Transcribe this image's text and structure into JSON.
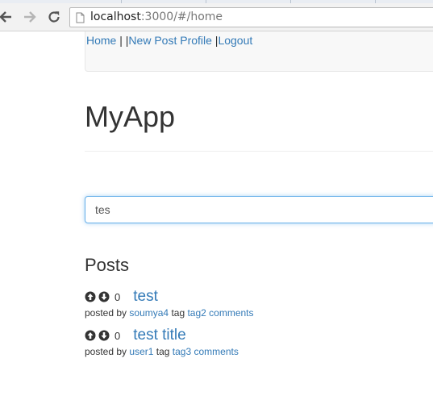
{
  "browser": {
    "url_host": "localhost",
    "url_path": ":3000/#/home"
  },
  "navbar": {
    "home": "Home",
    "sep1": " | |",
    "new_post": "New Post",
    "space": " ",
    "profile": "Profile",
    "sep2": " |",
    "logout": "Logout"
  },
  "header": {
    "title": "MyApp"
  },
  "search": {
    "value": "tes"
  },
  "posts": {
    "heading": "Posts",
    "posted_by_label": "posted by",
    "tag_label": "tag",
    "items": [
      {
        "votes": "0",
        "title": "test",
        "author": "soumya4",
        "tag": "tag2",
        "comments": "comments"
      },
      {
        "votes": "0",
        "title": "test title",
        "author": "user1",
        "tag": "tag3",
        "comments": "comments"
      }
    ]
  },
  "colors": {
    "link": "#337ab7",
    "focus": "#66afe9"
  }
}
